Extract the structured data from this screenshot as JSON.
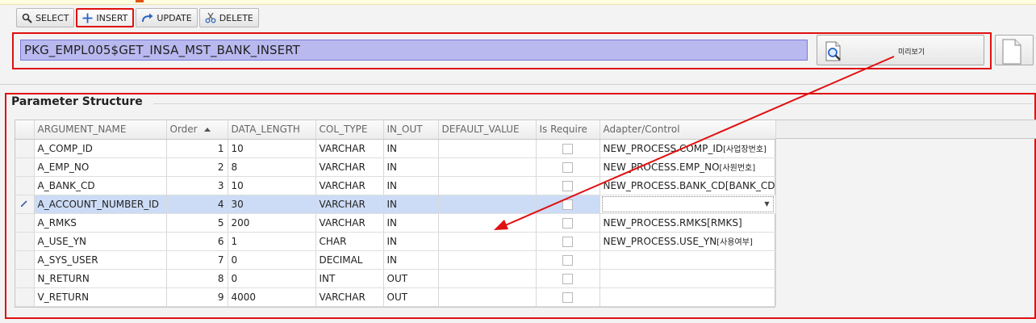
{
  "toolbar": {
    "select_label": "SELECT",
    "insert_label": "INSERT",
    "update_label": "UPDATE",
    "delete_label": "DELETE"
  },
  "procedure": {
    "name": "PKG_EMPL005$GET_INSA_MST_BANK_INSERT",
    "preview_label": "미리보기"
  },
  "section": {
    "title": "Parameter Structure"
  },
  "grid": {
    "columns": {
      "argument_name": "ARGUMENT_NAME",
      "order": "Order",
      "data_length": "DATA_LENGTH",
      "col_type": "COL_TYPE",
      "in_out": "IN_OUT",
      "default_value": "DEFAULT_VALUE",
      "is_require": "Is Require",
      "adapter": "Adapter/Control"
    },
    "rows": [
      {
        "name": "A_COMP_ID",
        "order": "1",
        "length": "10",
        "type": "VARCHAR",
        "inout": "IN",
        "default": "",
        "adapter": "NEW_PROCESS.COMP_ID",
        "adapter_kr": "[사업장번호]"
      },
      {
        "name": "A_EMP_NO",
        "order": "2",
        "length": "8",
        "type": "VARCHAR",
        "inout": "IN",
        "default": "",
        "adapter": "NEW_PROCESS.EMP_NO",
        "adapter_kr": "[사원번호]"
      },
      {
        "name": "A_BANK_CD",
        "order": "3",
        "length": "10",
        "type": "VARCHAR",
        "inout": "IN",
        "default": "",
        "adapter": "NEW_PROCESS.BANK_CD[BANK_CD]",
        "adapter_kr": ""
      },
      {
        "name": "A_ACCOUNT_NUMBER_ID",
        "order": "4",
        "length": "30",
        "type": "VARCHAR",
        "inout": "IN",
        "default": "",
        "adapter": "",
        "adapter_kr": ""
      },
      {
        "name": "A_RMKS",
        "order": "5",
        "length": "200",
        "type": "VARCHAR",
        "inout": "IN",
        "default": "",
        "adapter": "NEW_PROCESS.RMKS[RMKS]",
        "adapter_kr": ""
      },
      {
        "name": "A_USE_YN",
        "order": "6",
        "length": "1",
        "type": "CHAR",
        "inout": "IN",
        "default": "",
        "adapter": "NEW_PROCESS.USE_YN",
        "adapter_kr": "[사용여부]"
      },
      {
        "name": "A_SYS_USER",
        "order": "7",
        "length": "0",
        "type": "DECIMAL",
        "inout": "IN",
        "default": "",
        "adapter": "",
        "adapter_kr": ""
      },
      {
        "name": "N_RETURN",
        "order": "8",
        "length": "0",
        "type": "INT",
        "inout": "OUT",
        "default": "",
        "adapter": "",
        "adapter_kr": ""
      },
      {
        "name": "V_RETURN",
        "order": "9",
        "length": "4000",
        "type": "VARCHAR",
        "inout": "OUT",
        "default": "",
        "adapter": "",
        "adapter_kr": ""
      }
    ],
    "selected_row": 4
  },
  "icons": {
    "select": "magnifier-icon",
    "insert": "plus-icon",
    "update": "redo-arrow-icon",
    "delete": "scissors-icon",
    "preview": "page-magnifier-icon",
    "doc": "blank-document-icon",
    "row_edit": "pencil-icon",
    "dropdown": "dropdown-arrow-icon"
  },
  "colors": {
    "annotation_red": "#e01010",
    "procedure_highlight": "#b9b9f0",
    "selected_row": "#cddcf6"
  }
}
